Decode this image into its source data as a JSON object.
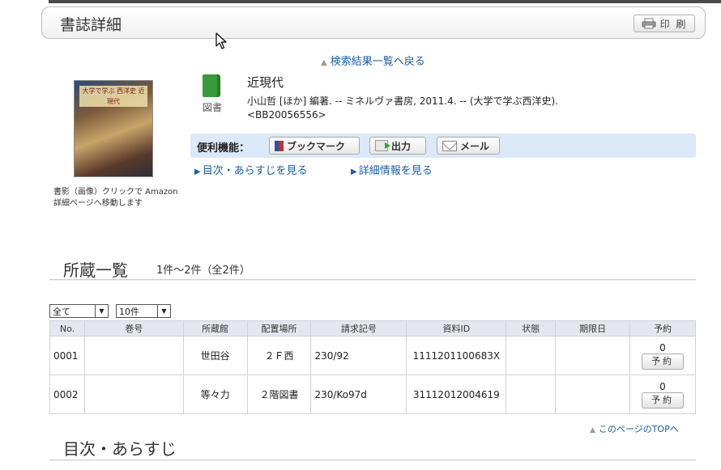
{
  "header": {
    "title": "書誌詳細",
    "print_label": "印 刷"
  },
  "nav": {
    "back_link": "検索結果一覧へ戻る",
    "page_top_link": "このページのTOPへ"
  },
  "book": {
    "cover_title": "大学で学ぶ 西洋史 近現代",
    "cover_note": "書影（画像）クリックで Amazon詳細ページへ移動します",
    "type_label": "図書",
    "title": "近現代",
    "meta_line1": "小山哲 [ほか] 編著. -- ミネルヴァ書房, 2011.4. -- (大学で学ぶ西洋史).",
    "meta_line2": "<BB20056556>"
  },
  "utilities": {
    "label": "便利機能：",
    "bookmark": "ブックマーク",
    "output": "出力",
    "mail": "メール"
  },
  "sub_links": {
    "toc": "目次・あらすじを見る",
    "details": "詳細情報を見る"
  },
  "holdings": {
    "heading": "所蔵一覧",
    "count_text": "1件～2件（全2件）",
    "filter_select": "全て",
    "perpage_select": "10件",
    "columns": [
      "No.",
      "巻号",
      "所蔵館",
      "配置場所",
      "請求記号",
      "資料ID",
      "状態",
      "期限日",
      "予約"
    ],
    "rows": [
      {
        "no": "0001",
        "volume": "",
        "library": "世田谷",
        "location": "２Ｆ西",
        "call_number": "230/92",
        "item_id": "1111201100683X",
        "status": "",
        "due": "",
        "reserve_count": "0",
        "reserve_label": "予約"
      },
      {
        "no": "0002",
        "volume": "",
        "library": "等々力",
        "location": "２階図書",
        "call_number": "230/Ko97d",
        "item_id": "31112012004619",
        "status": "",
        "due": "",
        "reserve_count": "0",
        "reserve_label": "予約"
      }
    ]
  },
  "toc_section": {
    "heading": "目次・あらすじ"
  }
}
